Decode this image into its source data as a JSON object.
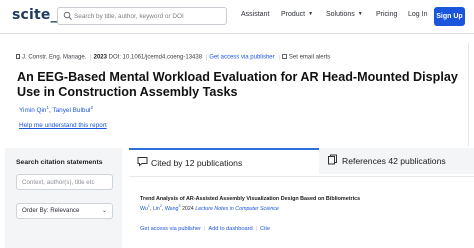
{
  "brand": {
    "logo": "scite_"
  },
  "search": {
    "placeholder": "Search by title, author, keyword or DOI"
  },
  "nav": {
    "assistant": "Assistant",
    "product": "Product",
    "solutions": "Solutions",
    "pricing": "Pricing",
    "login": "Log In",
    "signup": "Sign Up"
  },
  "paper": {
    "journal": "J. Constr. Eng. Manage.",
    "year": "2023",
    "doi": "DOI: 10.1061/jcemd4.coeng-13438",
    "access_link": "Get access via publisher",
    "alerts": "Set email alerts",
    "title": "An EEG-Based Mental Workload Evaluation for AR Head-Mounted Display Use in Construction Assembly Tasks",
    "authors": [
      {
        "name": "Yimin Qin",
        "sup": "1"
      },
      {
        "name": "Tanyel Bulbul",
        "sup": "2"
      }
    ],
    "help_link": "Help me understand this report"
  },
  "filters": {
    "heading": "Search citation statements",
    "input_placeholder": "Context, author(s), title etc",
    "order_label": "Order By: Relevance"
  },
  "tabs": {
    "cited_by": "Cited by 12 publications",
    "references": "References 42 publications"
  },
  "result": {
    "title": "Trend Analysis of AR-Assisted Assembly Visualization Design Based on Bibliometrics",
    "author1": "Wu",
    "author1_sup": "1",
    "author2": "Lin",
    "author2_sup": "2",
    "author3": "Wang",
    "author3_sup": "3",
    "year": "2024",
    "venue": "Lecture Notes in Computer Science",
    "actions": {
      "access": "Get access via publisher",
      "dashboard": "Add to dashboard",
      "cite": "Cite"
    }
  },
  "colors": {
    "accent": "#1a56db",
    "brand": "#1f3a5f",
    "tab_active": "#2b6fdc"
  }
}
